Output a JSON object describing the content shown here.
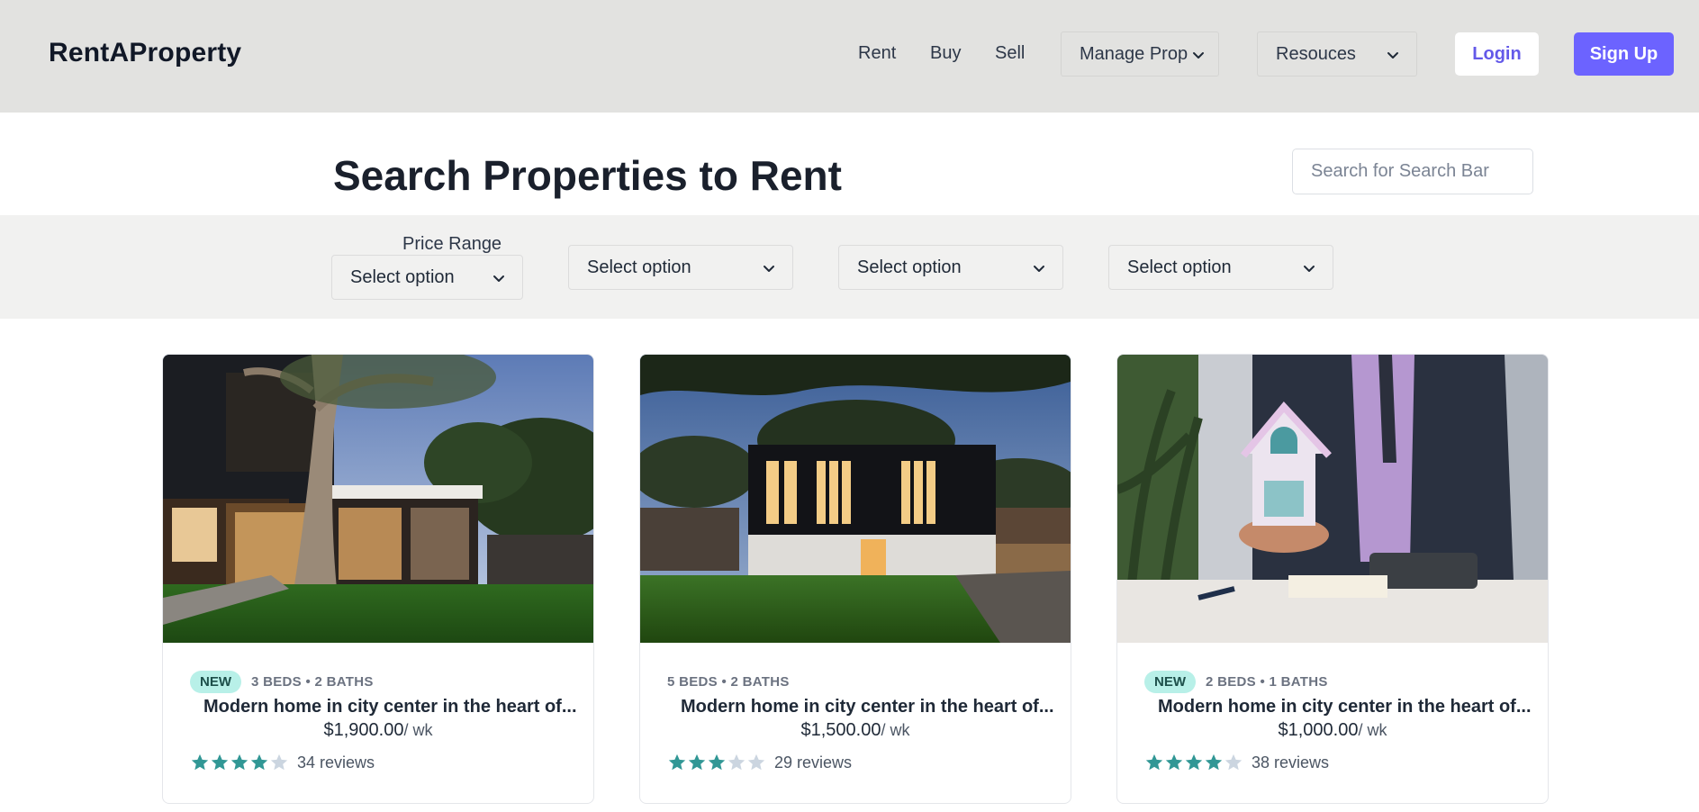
{
  "header": {
    "brand": "RentAProperty",
    "nav": {
      "rent": "Rent",
      "buy": "Buy",
      "sell": "Sell"
    },
    "menus": {
      "manage": "Manage Prop",
      "resources": "Resouces"
    },
    "login_label": "Login",
    "signup_label": "Sign Up"
  },
  "main": {
    "title": "Search Properties to Rent",
    "search_placeholder": "Search for Search Bar"
  },
  "filters": {
    "price_label": "Price Range",
    "selects": [
      "Select option",
      "Select option",
      "Select option",
      "Select option"
    ]
  },
  "listings": [
    {
      "badge": "NEW",
      "beds": "3 BEDS • 2 BATHS",
      "title": "Modern home in city center in the heart of...",
      "price": "$1,900.00",
      "unit": "/ wk",
      "rating": 4,
      "reviews": "34 reviews"
    },
    {
      "badge": "",
      "beds": "5 BEDS • 2 BATHS",
      "title": "Modern home in city center in the heart of...",
      "price": "$1,500.00",
      "unit": "/ wk",
      "rating": 3,
      "reviews": "29 reviews"
    },
    {
      "badge": "NEW",
      "beds": "2 BEDS • 1 BATHS",
      "title": "Modern home in city center in the heart of...",
      "price": "$1,000.00",
      "unit": "/ wk",
      "rating": 4,
      "reviews": "38 reviews"
    }
  ],
  "colors": {
    "header_bg": "#e2e2e0",
    "accent": "#6c63ff",
    "badge_bg": "#b8f0e8",
    "star_filled": "#319795",
    "star_empty": "#cbd5e0"
  }
}
